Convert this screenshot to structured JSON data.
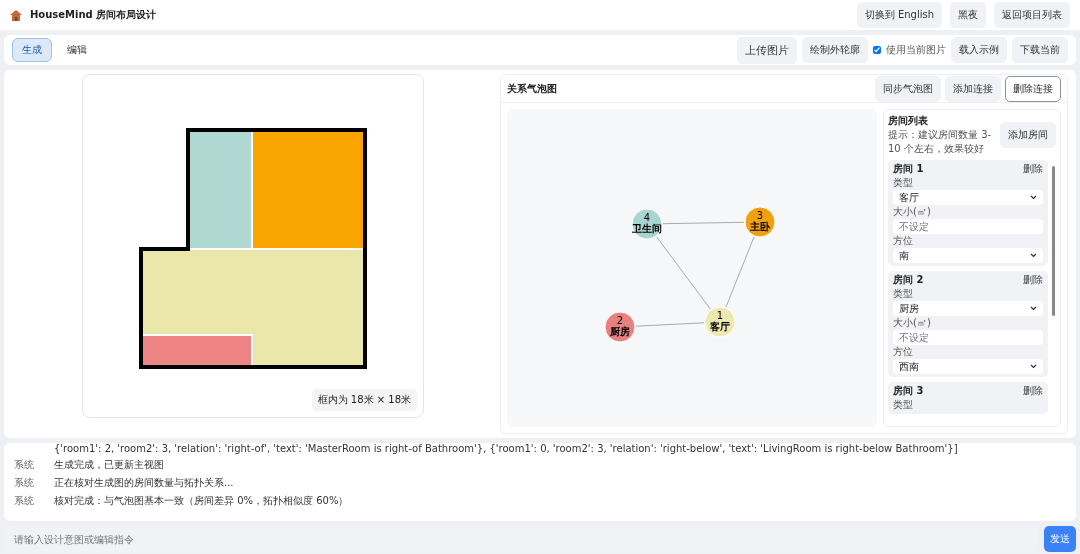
{
  "header": {
    "title": "HouseMind 房间布局设计",
    "buttons": [
      "切换到 English",
      "黑夜",
      "返回项目列表"
    ]
  },
  "toolbar": {
    "tabs": [
      {
        "label": "生成",
        "selected": true
      },
      {
        "label": "编辑",
        "selected": false
      }
    ],
    "upload": "上传图片",
    "outline": "绘制外轮廓",
    "use_current": {
      "label": "使用当前图片",
      "checked": true
    },
    "actions": [
      "载入示例",
      "下载当前"
    ]
  },
  "plan": {
    "caption": "框内为 18米 × 18米"
  },
  "bubble": {
    "title": "关系气泡图",
    "buttons": [
      {
        "label": "同步气泡图",
        "selected": false
      },
      {
        "label": "添加连接",
        "selected": false
      },
      {
        "label": "删除连接",
        "selected": true
      }
    ],
    "nodes": [
      {
        "number": "4",
        "label": "卫生间",
        "color": "#a8d5d0"
      },
      {
        "number": "3",
        "label": "主卧",
        "color": "#f0a010"
      },
      {
        "number": "1",
        "label": "客厅",
        "color": "#ece8b0"
      },
      {
        "number": "2",
        "label": "厨房",
        "color": "#e88080"
      }
    ]
  },
  "room_list": {
    "title": "房间列表",
    "hint": "提示：建议房间数量 3-10 个左右，效果较好",
    "add": "添加房间",
    "rooms": [
      {
        "title": "房间 1",
        "delete": "删除",
        "type_label": "类型",
        "type": "客厅",
        "size_label": "大小(㎡)",
        "size_placeholder": "不设定",
        "dir_label": "方位",
        "dir": "南"
      },
      {
        "title": "房间 2",
        "delete": "删除",
        "type_label": "类型",
        "type": "厨房",
        "size_label": "大小(㎡)",
        "size_placeholder": "不设定",
        "dir_label": "方位",
        "dir": "西南"
      },
      {
        "title": "房间 3",
        "delete": "删除",
        "type_label": "类型"
      }
    ]
  },
  "log": [
    {
      "text": "{'room1': 2, 'room2': 3, 'relation': 'right-of', 'text': 'MasterRoom is right-of Bathroom'}, {'room1': 0, 'room2': 3, 'relation': 'right-below', 'text': 'LivingRoom is right-below Bathroom'}]"
    },
    {
      "sender": "系统",
      "text": "生成完成，已更新主视图"
    },
    {
      "sender": "系统",
      "text": "正在核对生成图的房间数量与拓扑关系..."
    },
    {
      "sender": "系统",
      "text": "核对完成：与气泡图基本一致（房间差异 0%，拓扑相似度 60%）"
    }
  ],
  "input": {
    "placeholder": "请输入设计意图或编辑指令",
    "send": "发送"
  }
}
